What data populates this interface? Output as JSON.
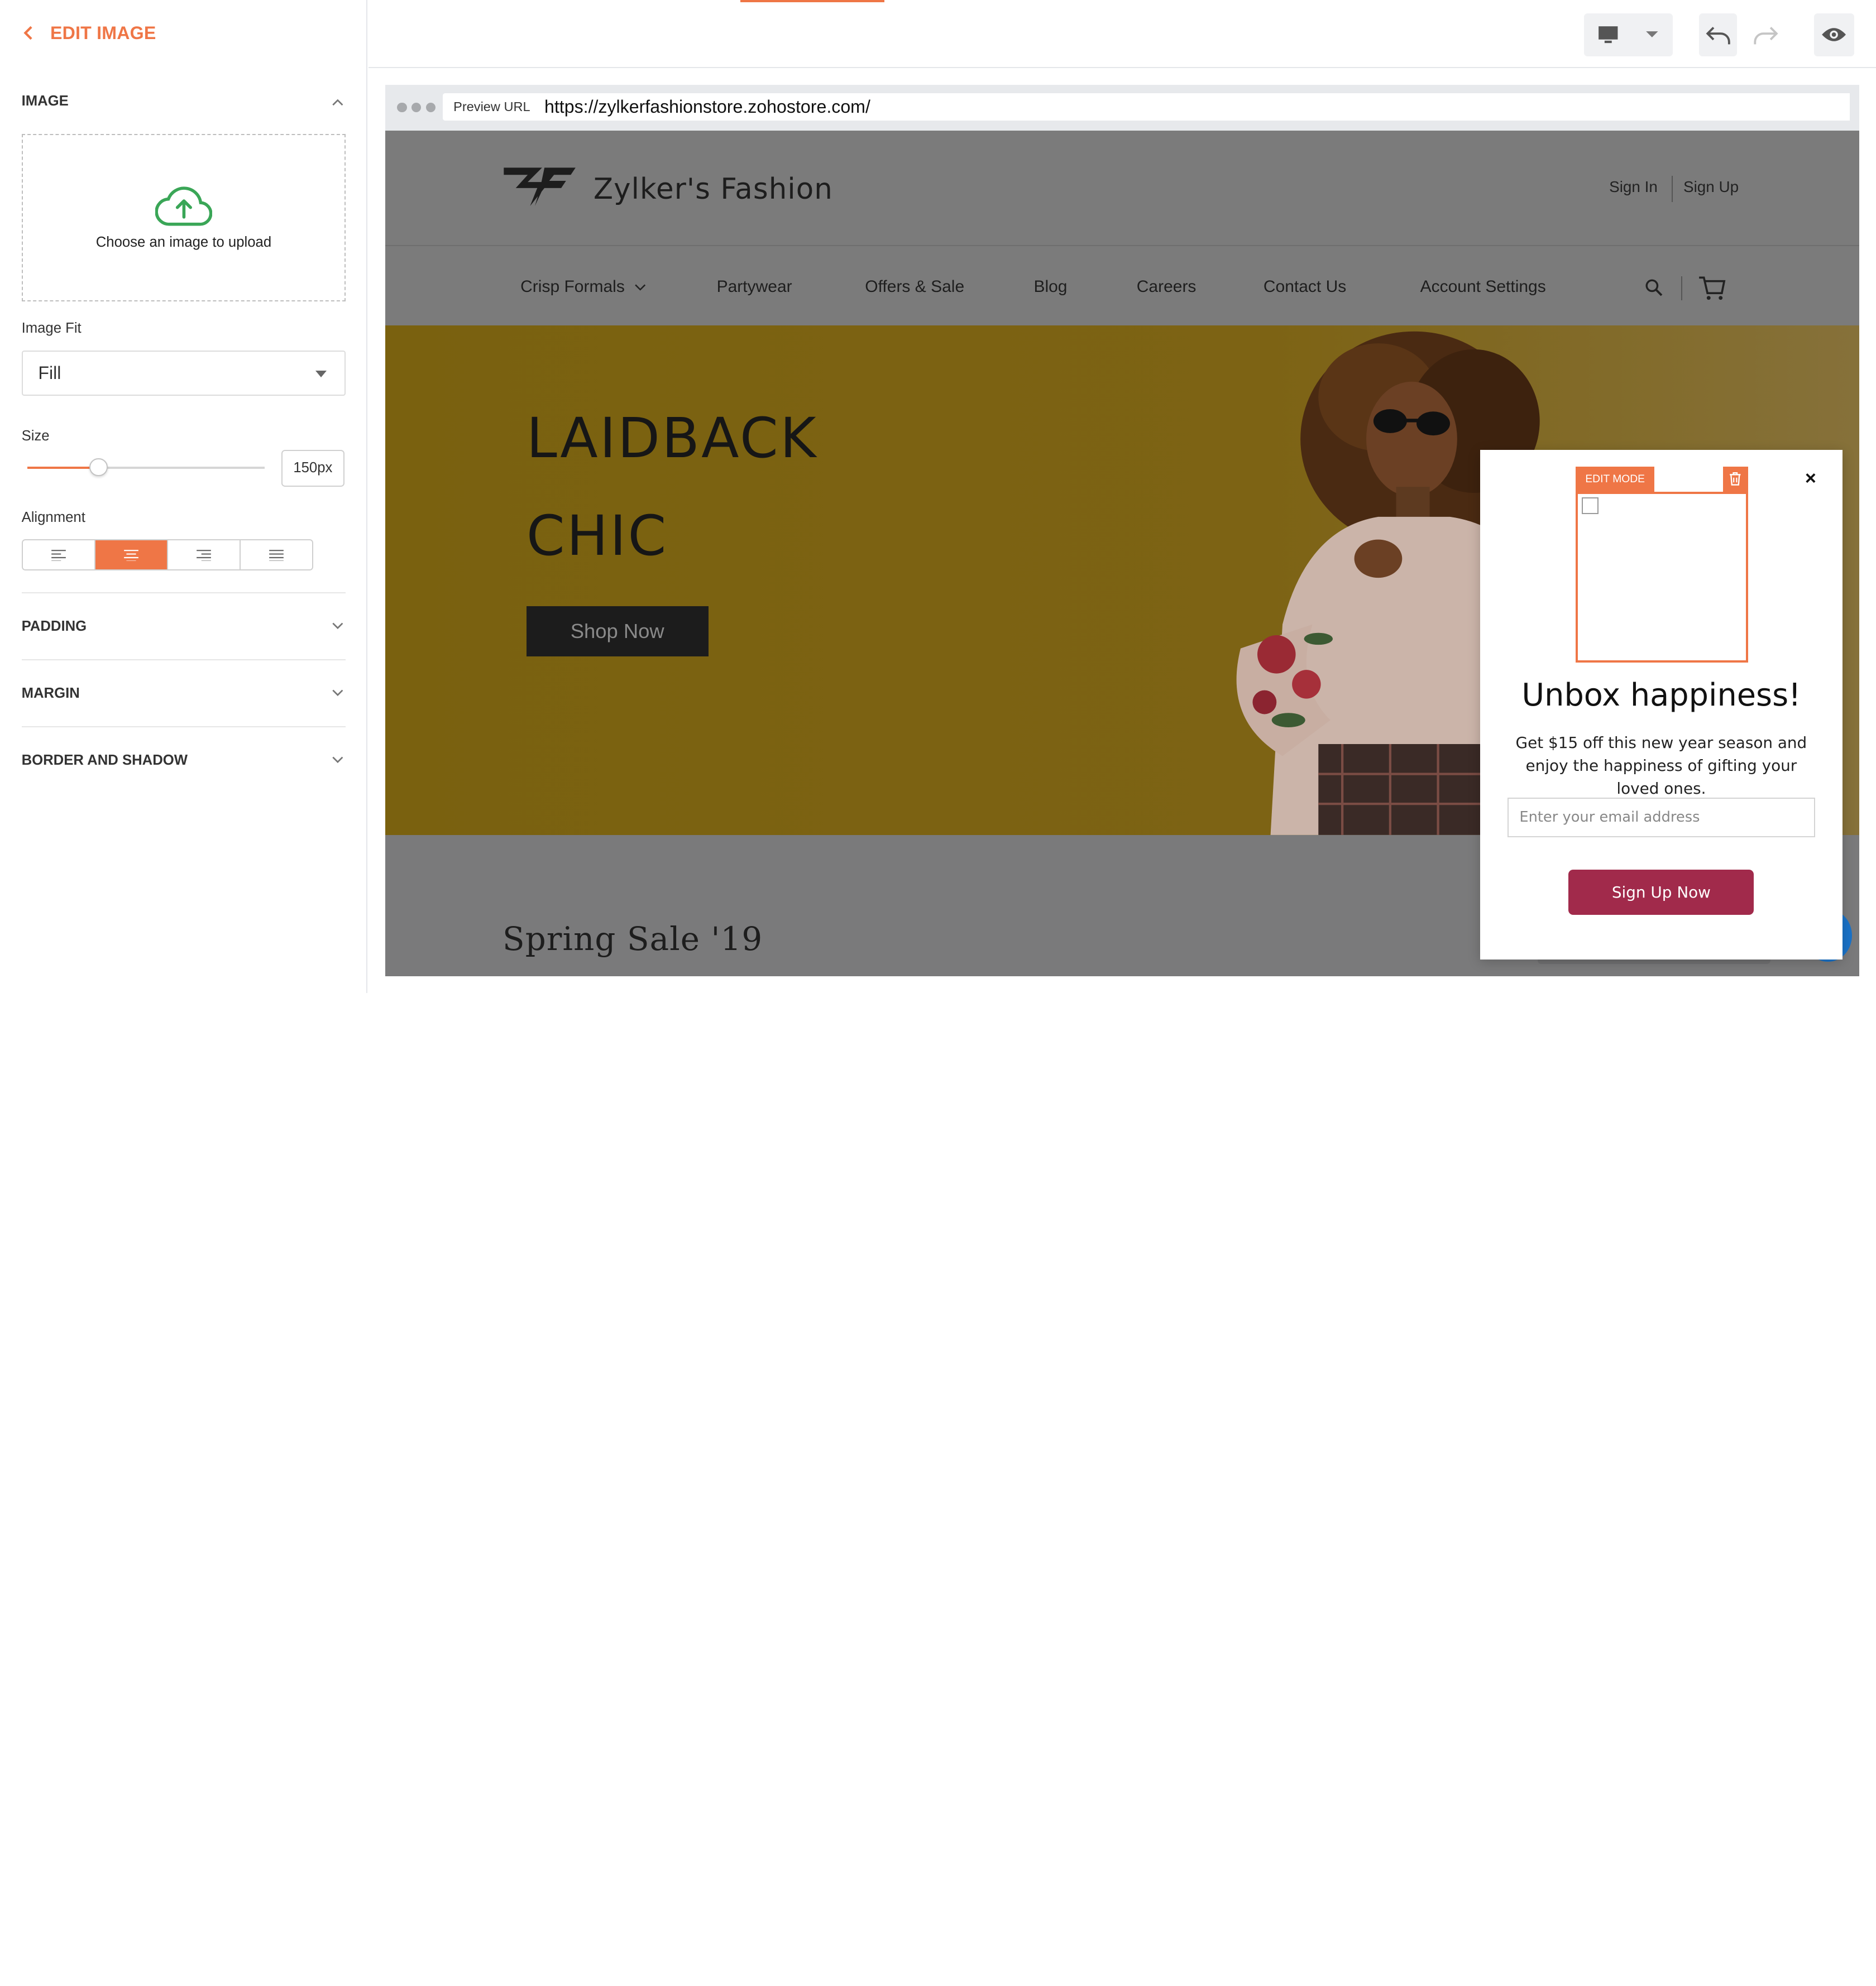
{
  "left_panel": {
    "back_icon": "chevron-left-icon",
    "title": "EDIT IMAGE",
    "image_section": "IMAGE",
    "upload_text": "Choose an image to upload",
    "image_fit_label": "Image Fit",
    "image_fit_value": "Fill",
    "size_label": "Size",
    "size_value": "150px",
    "size_fraction": 0.3,
    "alignment_label": "Alignment",
    "alignment_options": [
      "left",
      "center",
      "right",
      "justify"
    ],
    "alignment_selected": "center",
    "padding_section": "PADDING",
    "margin_section": "MARGIN",
    "border_section": "BORDER AND SHADOW"
  },
  "toolbar": {
    "device_icon": "monitor-icon",
    "undo_icon": "undo-icon",
    "redo_icon": "redo-icon",
    "preview_icon": "eye-icon"
  },
  "browser": {
    "preview_label": "Preview URL",
    "url": "https://zylkerfashionstore.zohostore.com/"
  },
  "site": {
    "brand": "Zylker's Fashion",
    "sign_in": "Sign In",
    "sign_up": "Sign Up",
    "nav": [
      "Crisp Formals",
      "Partywear",
      "Offers & Sale",
      "Blog",
      "Careers",
      "Contact Us",
      "Account Settings"
    ],
    "hero_line1": "LAIDBACK",
    "hero_line2": "CHIC",
    "hero_button": "Shop Now",
    "section_heading": "Spring Sale '19"
  },
  "popup": {
    "close": "×",
    "edit_tag": "EDIT MODE",
    "title": "Unbox happiness!",
    "body": "Get $15 off this new year season and enjoy the happiness of gifting your loved ones.",
    "email_placeholder": "Enter your email address",
    "button": "Sign Up Now"
  },
  "colors": {
    "accent": "#ef7646",
    "popup_button": "#a12a4b",
    "hero_bg": "#7a6212"
  }
}
